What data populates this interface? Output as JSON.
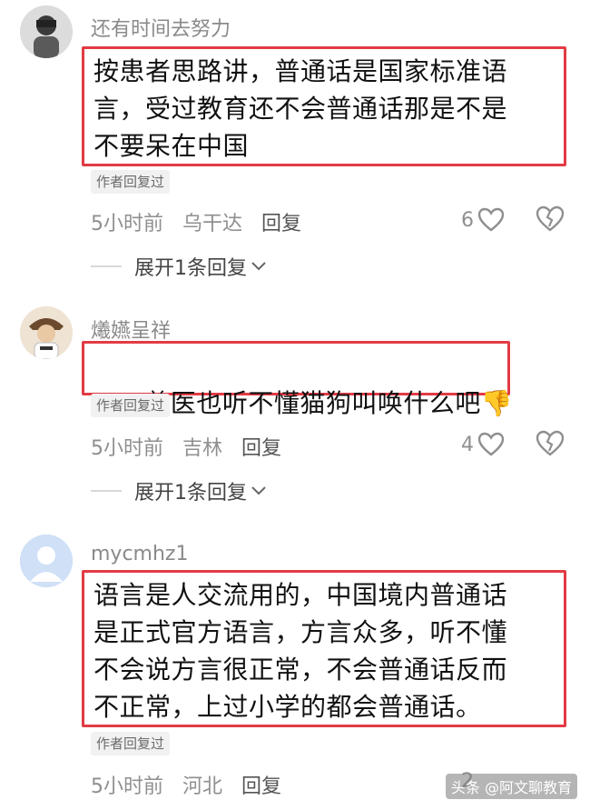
{
  "comments": [
    {
      "username": "还有时间去努力",
      "content": "按患者思路讲，普通话是国家标准语\n言，受过教育还不会普通话那是不是\n不要呆在中国",
      "badge": "作者回复过",
      "time": "5小时前",
      "location": "乌干达",
      "reply_label": "回复",
      "likes": "6",
      "expand_label": "展开1条回复"
    },
    {
      "username": "爔嬿呈祥",
      "content": "兽医也听不懂猫狗叫唤什么吧",
      "emoji": "👎",
      "badge": "作者回复过",
      "time": "5小时前",
      "location": "吉林",
      "reply_label": "回复",
      "likes": "4",
      "expand_label": "展开1条回复"
    },
    {
      "username": "mycmhz1",
      "content": "语言是人交流用的，中国境内普通话\n是正式官方语言，方言众多，听不懂\n不会说方言很正常，不会普通话反而\n不正常，上过小学的都会普通话。",
      "badge": "作者回复过",
      "time": "5小时前",
      "location": "河北",
      "reply_label": "回复",
      "likes": "2"
    }
  ],
  "watermark": "头条 @阿文聊教育",
  "colors": {
    "highlight_border": "#e23b45",
    "meta_text": "#8f8f8f"
  },
  "icons": [
    "avatar-person-icon",
    "heart-icon",
    "broken-heart-icon",
    "chevron-down-icon",
    "thumbs-down-emoji"
  ]
}
